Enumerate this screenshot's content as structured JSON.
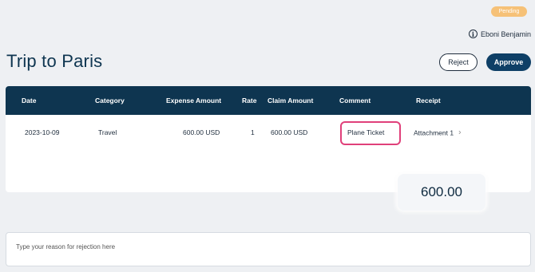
{
  "status": "Pending",
  "user": {
    "name": "Eboni Benjamin",
    "icon": "info-icon"
  },
  "title": "Trip to Paris",
  "actions": {
    "reject": "Reject",
    "approve": "Approve"
  },
  "table": {
    "headers": [
      "Date",
      "Category",
      "Expense Amount",
      "Rate",
      "Claim Amount",
      "Comment",
      "Receipt"
    ],
    "rows": [
      {
        "date": "2023-10-09",
        "category": "Travel",
        "expense_amount": "600.00 USD",
        "rate": "1",
        "claim_amount": "600.00 USD",
        "comment": "Plane Ticket",
        "receipt": "Attachment 1"
      }
    ]
  },
  "total": "600.00",
  "reason_placeholder": "Type your reason for rejection here",
  "colors": {
    "header": "#0e3550",
    "approve": "#0e3f66",
    "badge": "#f6c177",
    "highlight": "#e0407a"
  }
}
